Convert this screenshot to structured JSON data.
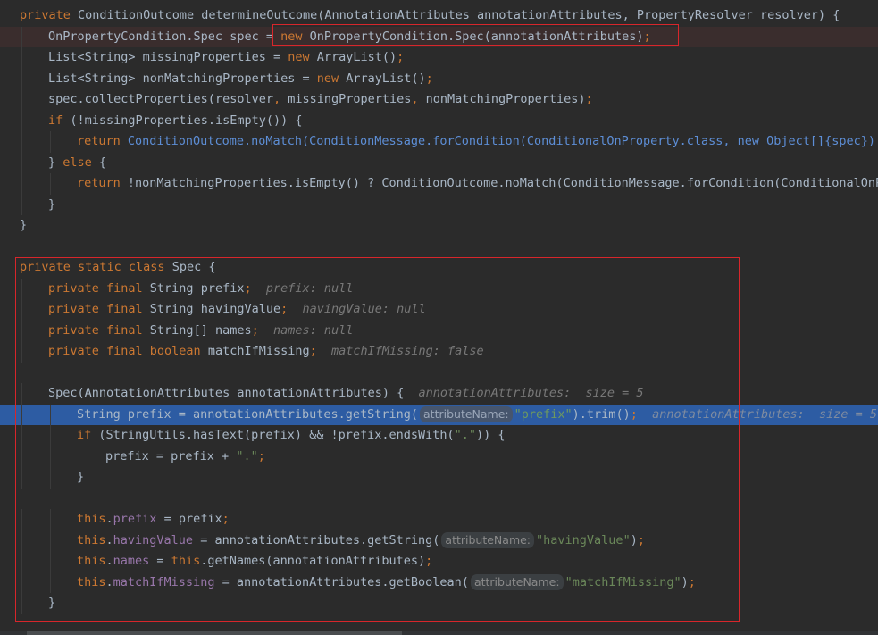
{
  "editor": {
    "theme_colors": {
      "background": "#2b2b2b",
      "keyword": "#cc7832",
      "string": "#6a8759",
      "field": "#9876aa",
      "hint": "#787878",
      "current_line": "#2d5ca3",
      "annotation_box": "#d8262b"
    },
    "lines": [
      {
        "indent": 0,
        "tokens": [
          {
            "t": "kw",
            "v": "private "
          },
          {
            "t": "plain",
            "v": "ConditionOutcome determineOutcome(AnnotationAttributes annotationAttributes, PropertyResolver resolver) {"
          }
        ]
      },
      {
        "indent": 1,
        "hl": "error",
        "tokens": [
          {
            "t": "plain",
            "v": "OnPropertyCondition.Spec spec = "
          },
          {
            "t": "kw",
            "v": "new "
          },
          {
            "t": "plain",
            "v": "OnPropertyCondition.Spec(annotationAttributes)"
          },
          {
            "t": "punct",
            "v": ";"
          }
        ]
      },
      {
        "indent": 1,
        "tokens": [
          {
            "t": "plain",
            "v": "List<String> missingProperties = "
          },
          {
            "t": "kw",
            "v": "new "
          },
          {
            "t": "plain",
            "v": "ArrayList()"
          },
          {
            "t": "punct",
            "v": ";"
          }
        ]
      },
      {
        "indent": 1,
        "tokens": [
          {
            "t": "plain",
            "v": "List<String> nonMatchingProperties = "
          },
          {
            "t": "kw",
            "v": "new "
          },
          {
            "t": "plain",
            "v": "ArrayList()"
          },
          {
            "t": "punct",
            "v": ";"
          }
        ]
      },
      {
        "indent": 1,
        "tokens": [
          {
            "t": "plain",
            "v": "spec.collectProperties(resolver"
          },
          {
            "t": "punct",
            "v": ", "
          },
          {
            "t": "plain",
            "v": "missingProperties"
          },
          {
            "t": "punct",
            "v": ", "
          },
          {
            "t": "plain",
            "v": "nonMatchingProperties)"
          },
          {
            "t": "punct",
            "v": ";"
          }
        ]
      },
      {
        "indent": 1,
        "tokens": [
          {
            "t": "kw",
            "v": "if "
          },
          {
            "t": "plain",
            "v": "(!missingProperties.isEmpty()) {"
          }
        ]
      },
      {
        "indent": 2,
        "tokens": [
          {
            "t": "kw",
            "v": "return "
          },
          {
            "t": "link",
            "v": "ConditionOutcome.noMatch(ConditionMessage.forCondition(ConditionalOnProperty.class, new Object[]{spec}).d"
          }
        ]
      },
      {
        "indent": 1,
        "tokens": [
          {
            "t": "plain",
            "v": "} "
          },
          {
            "t": "kw",
            "v": "else "
          },
          {
            "t": "plain",
            "v": "{"
          }
        ]
      },
      {
        "indent": 2,
        "tokens": [
          {
            "t": "kw",
            "v": "return "
          },
          {
            "t": "plain",
            "v": "!nonMatchingProperties.isEmpty() ? ConditionOutcome.noMatch(ConditionMessage.forCondition(ConditionalOnPr"
          }
        ]
      },
      {
        "indent": 1,
        "tokens": [
          {
            "t": "plain",
            "v": "}"
          }
        ]
      },
      {
        "indent": 0,
        "tokens": [
          {
            "t": "plain",
            "v": "}"
          }
        ]
      },
      {
        "indent": 0,
        "tokens": []
      },
      {
        "indent": 0,
        "tokens": [
          {
            "t": "kw",
            "v": "private static class "
          },
          {
            "t": "plain",
            "v": "Spec {"
          }
        ]
      },
      {
        "indent": 1,
        "tokens": [
          {
            "t": "kw",
            "v": "private final "
          },
          {
            "t": "plain",
            "v": "String prefix"
          },
          {
            "t": "punct",
            "v": ";"
          },
          {
            "t": "hint",
            "v": "  prefix: null"
          }
        ]
      },
      {
        "indent": 1,
        "tokens": [
          {
            "t": "kw",
            "v": "private final "
          },
          {
            "t": "plain",
            "v": "String havingValue"
          },
          {
            "t": "punct",
            "v": ";"
          },
          {
            "t": "hint",
            "v": "  havingValue: null"
          }
        ]
      },
      {
        "indent": 1,
        "tokens": [
          {
            "t": "kw",
            "v": "private final "
          },
          {
            "t": "plain",
            "v": "String[] names"
          },
          {
            "t": "punct",
            "v": ";"
          },
          {
            "t": "hint",
            "v": "  names: null"
          }
        ]
      },
      {
        "indent": 1,
        "tokens": [
          {
            "t": "kw",
            "v": "private final boolean "
          },
          {
            "t": "plain",
            "v": "matchIfMissing"
          },
          {
            "t": "punct",
            "v": ";"
          },
          {
            "t": "hint",
            "v": "  matchIfMissing: false"
          }
        ]
      },
      {
        "indent": 0,
        "tokens": []
      },
      {
        "indent": 1,
        "tokens": [
          {
            "t": "plain",
            "v": "Spec(AnnotationAttributes annotationAttributes) {"
          },
          {
            "t": "hint",
            "v": "  annotationAttributes:  size = 5"
          }
        ]
      },
      {
        "indent": 2,
        "hl": "current",
        "tokens": [
          {
            "t": "plain",
            "v": "String prefix = annotationAttributes.getString("
          },
          {
            "t": "param",
            "v": "attributeName:"
          },
          {
            "t": "str",
            "v": "\"prefix\""
          },
          {
            "t": "plain",
            "v": ").trim()"
          },
          {
            "t": "punct",
            "v": ";"
          },
          {
            "t": "hint",
            "v": "  annotationAttributes:  size = 5"
          }
        ]
      },
      {
        "indent": 2,
        "tokens": [
          {
            "t": "kw",
            "v": "if "
          },
          {
            "t": "plain",
            "v": "(StringUtils.hasText(prefix) && !prefix.endsWith("
          },
          {
            "t": "str",
            "v": "\".\""
          },
          {
            "t": "plain",
            "v": ")) {"
          }
        ]
      },
      {
        "indent": 3,
        "tokens": [
          {
            "t": "plain",
            "v": "prefix = prefix + "
          },
          {
            "t": "str",
            "v": "\".\""
          },
          {
            "t": "punct",
            "v": ";"
          }
        ]
      },
      {
        "indent": 2,
        "tokens": [
          {
            "t": "plain",
            "v": "}"
          }
        ]
      },
      {
        "indent": 0,
        "tokens": []
      },
      {
        "indent": 2,
        "tokens": [
          {
            "t": "kw",
            "v": "this"
          },
          {
            "t": "plain",
            "v": "."
          },
          {
            "t": "field",
            "v": "prefix"
          },
          {
            "t": "plain",
            "v": " = prefix"
          },
          {
            "t": "punct",
            "v": ";"
          }
        ]
      },
      {
        "indent": 2,
        "tokens": [
          {
            "t": "kw",
            "v": "this"
          },
          {
            "t": "plain",
            "v": "."
          },
          {
            "t": "field",
            "v": "havingValue"
          },
          {
            "t": "plain",
            "v": " = annotationAttributes.getString("
          },
          {
            "t": "param",
            "v": "attributeName:"
          },
          {
            "t": "str",
            "v": "\"havingValue\""
          },
          {
            "t": "plain",
            "v": ")"
          },
          {
            "t": "punct",
            "v": ";"
          }
        ]
      },
      {
        "indent": 2,
        "tokens": [
          {
            "t": "kw",
            "v": "this"
          },
          {
            "t": "plain",
            "v": "."
          },
          {
            "t": "field",
            "v": "names"
          },
          {
            "t": "plain",
            "v": " = "
          },
          {
            "t": "kw",
            "v": "this"
          },
          {
            "t": "plain",
            "v": ".getNames(annotationAttributes)"
          },
          {
            "t": "punct",
            "v": ";"
          }
        ]
      },
      {
        "indent": 2,
        "tokens": [
          {
            "t": "kw",
            "v": "this"
          },
          {
            "t": "plain",
            "v": "."
          },
          {
            "t": "field",
            "v": "matchIfMissing"
          },
          {
            "t": "plain",
            "v": " = annotationAttributes.getBoolean("
          },
          {
            "t": "param",
            "v": "attributeName:"
          },
          {
            "t": "str",
            "v": "\"matchIfMissing\""
          },
          {
            "t": "plain",
            "v": ")"
          },
          {
            "t": "punct",
            "v": ";"
          }
        ]
      },
      {
        "indent": 1,
        "tokens": [
          {
            "t": "plain",
            "v": "}"
          }
        ]
      }
    ]
  }
}
